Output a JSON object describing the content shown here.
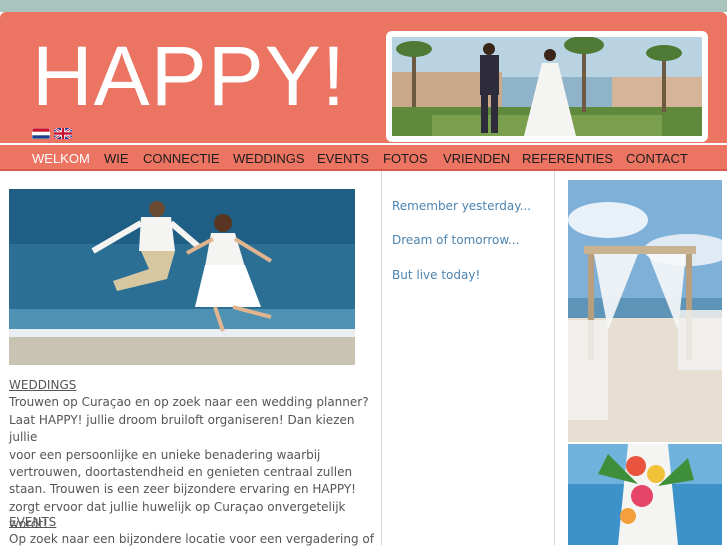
{
  "brand": {
    "logo_text": "HAPPY!"
  },
  "languages": [
    {
      "icon": "flag-netherlands-icon"
    },
    {
      "icon": "flag-uk-icon"
    }
  ],
  "nav": {
    "items": [
      {
        "label": "WELKOM",
        "active": true
      },
      {
        "label": "WIE"
      },
      {
        "label": "CONNECTIE"
      },
      {
        "label": "WEDDINGS"
      },
      {
        "label": "EVENTS"
      },
      {
        "label": "FOTOS"
      },
      {
        "label": "VRIENDEN"
      },
      {
        "label": "REFERENTIES"
      },
      {
        "label": "CONTACT"
      }
    ]
  },
  "content": {
    "sections": [
      {
        "title": "WEDDINGS",
        "lines": [
          "Trouwen op Curaçao en op zoek naar een wedding planner?",
          "Laat HAPPY! jullie droom bruiloft organiseren! Dan kiezen jullie",
          "voor een persoonlijke en unieke benadering waarbij",
          "vertrouwen, doortastendheid en genieten centraal zullen",
          "staan. Trouwen is een zeer bijzondere ervaring en HAPPY!",
          "zorgt ervoor dat jullie huwelijk op Curaçao onvergetelijk wordt!"
        ]
      },
      {
        "title": "EVENTS",
        "lines": [
          "Op zoek naar een bijzondere locatie voor een vergadering of"
        ]
      }
    ]
  },
  "quotes": [
    "Remember yesterday...",
    "Dream of tomorrow...",
    "But live today!"
  ],
  "colors": {
    "header": "#ec7462",
    "top_strip": "#a9c4bd",
    "quote_text": "#4d84b0",
    "body_text": "#555555",
    "nav_active": "#ffffff"
  }
}
